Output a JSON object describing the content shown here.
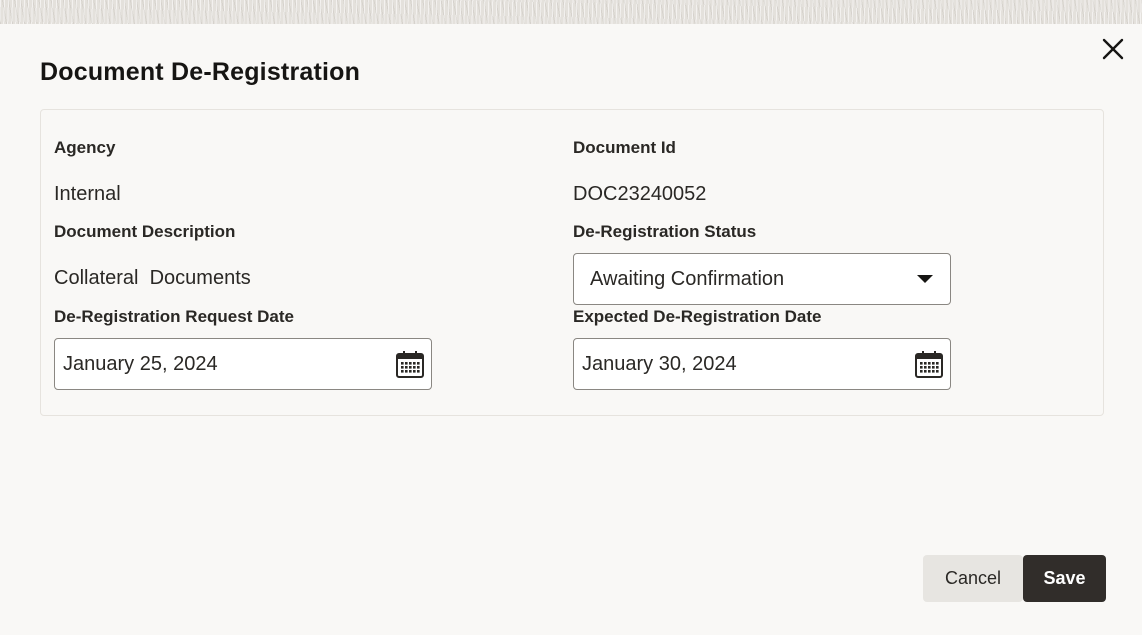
{
  "dialog": {
    "title": "Document De-Registration",
    "close_icon": "close-icon"
  },
  "form": {
    "agency": {
      "label": "Agency",
      "value": "Internal"
    },
    "document_id": {
      "label": "Document Id",
      "value": "DOC23240052"
    },
    "document_description": {
      "label": "Document Description",
      "value": "Collateral  Documents"
    },
    "deregistration_status": {
      "label": "De-Registration Status",
      "selected": "Awaiting Confirmation",
      "icon": "chevron-down-icon"
    },
    "request_date": {
      "label": "De-Registration Request Date",
      "value": "January 25, 2024",
      "icon": "calendar-icon"
    },
    "expected_date": {
      "label": "Expected De-Registration Date",
      "value": "January 30, 2024",
      "icon": "calendar-icon"
    }
  },
  "footer": {
    "cancel_label": "Cancel",
    "save_label": "Save"
  },
  "colors": {
    "primary_button": "#312d2a",
    "secondary_button": "#e7e5e1",
    "dialog_background": "#f9f8f6"
  }
}
